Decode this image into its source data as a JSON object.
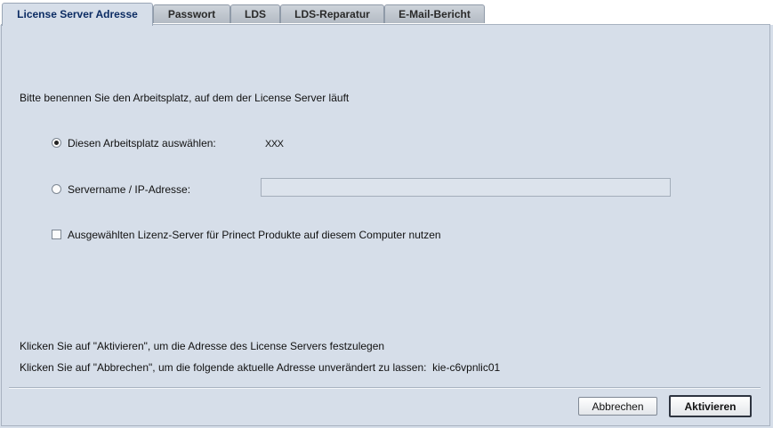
{
  "tabs": [
    {
      "label": "License Server Adresse",
      "active": true
    },
    {
      "label": "Passwort",
      "active": false
    },
    {
      "label": "LDS",
      "active": false
    },
    {
      "label": "LDS-Reparatur",
      "active": false
    },
    {
      "label": "E-Mail-Bericht",
      "active": false
    }
  ],
  "main": {
    "intro": "Bitte benennen Sie den Arbeitsplatz, auf dem der License Server läuft",
    "option_local": {
      "label": "Diesen Arbeitsplatz auswählen:",
      "value": "XXX",
      "selected": true
    },
    "option_server": {
      "label": "Servername / IP-Adresse:",
      "value": "",
      "placeholder": "",
      "selected": false
    },
    "use_server_checkbox": {
      "label": "Ausgewählten Lizenz-Server für Prinect Produkte auf diesem Computer nutzen",
      "checked": false
    },
    "info_activate": "Klicken Sie auf \"Aktivieren\", um die Adresse des License Servers festzulegen",
    "info_cancel": "Klicken Sie auf \"Abbrechen\", um die folgende aktuelle Adresse unverändert zu lassen:",
    "current_address": "kie-c6vpnlic01"
  },
  "footer": {
    "cancel_label": "Abbrechen",
    "activate_label": "Aktivieren"
  },
  "colors": {
    "panel_bg": "#d6dee9",
    "active_tab_text": "#0c2c63"
  },
  "icons": {
    "radio_selected": "radio-selected-icon",
    "radio_unselected": "radio-unselected-icon",
    "checkbox_unchecked": "checkbox-unchecked-icon"
  }
}
